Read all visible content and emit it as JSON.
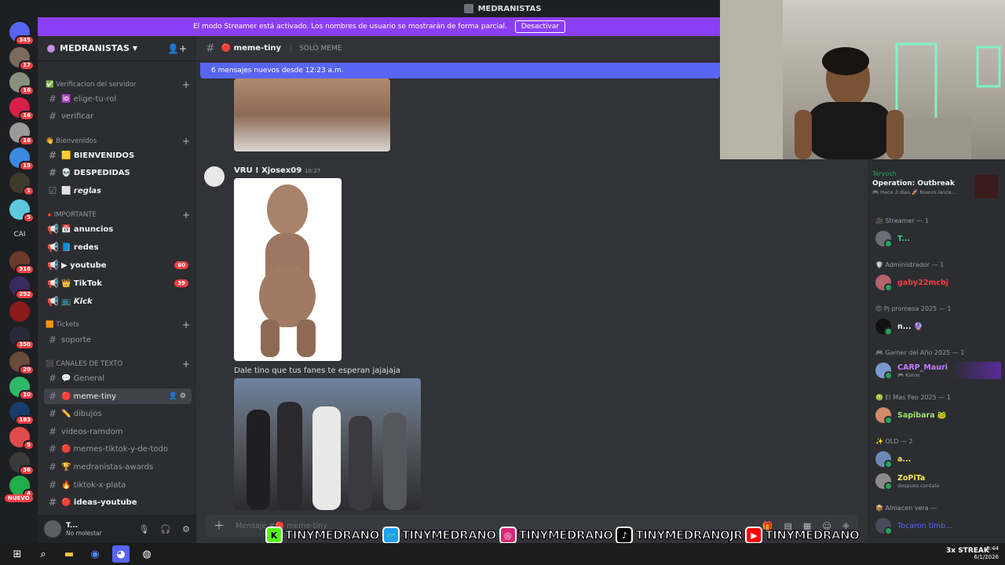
{
  "window": {
    "title": "MEDRANISTAS"
  },
  "banner": {
    "text": "El modo Streamer está activado. Los nombres de usuario se mostrarán de forma parcial.",
    "button": "Desactivar"
  },
  "rail": {
    "badges": [
      "345",
      "17",
      "16",
      "16",
      "16",
      "15",
      "16",
      "1",
      "5",
      "316",
      "292",
      "350",
      "20",
      "10",
      "183",
      "5",
      "36",
      "4"
    ],
    "new_label": "NUEVO",
    "cai_label": "CAI"
  },
  "server": {
    "name": "MEDRANISTAS"
  },
  "categories": {
    "verificacion": "✅ Verificacion del servidor",
    "bienvenidos": "👋 Bienvenidos",
    "importante": "🔺IMPORTANTE",
    "tickets": "🟧 Tickets",
    "canales": "⬛ CANALES DE TEXTO"
  },
  "channels": {
    "elige": "🆔 elige-tu-rol",
    "verificar": "verificar",
    "bienvenidos": "🟨 BIENVENIDOS",
    "despedidas": "💀 DESPEDIDAS",
    "reglas": "⬜ 𝙧𝙚𝙜𝙡𝙖𝙨",
    "anuncios": "📅 anuncios",
    "redes": "📘 redes",
    "youtube": "▶ youtube",
    "youtube_count": "60",
    "tiktok": "👑 TikTok",
    "tiktok_count": "39",
    "kick": "📺 𝙆𝙞𝙘𝙠",
    "soporte": "soporte",
    "general": "💬 General",
    "meme_tiny": "🔴 meme-tiny",
    "dibujos": "✏️ dibujos",
    "videos": "videos-ramdom",
    "memes_tiktok": "🔴 memes-tiktok-y-de-todo",
    "awards": "🏆 medranistas-awards",
    "tiktok_plata": "🔥 tiktok-x-plata",
    "ideas": "🔴 ideas-youtube"
  },
  "user": {
    "name": "T...",
    "status": "No molestar"
  },
  "chat": {
    "channel_name": "🔴 meme-tiny",
    "topic": "SOLO MEME",
    "new_messages": "6 mensajes nuevos desde 12:23 a.m.",
    "author": "VRU ! Xjosex09",
    "time": "18:27",
    "message": "Dale tino que tus fanes te esperan jajajaja",
    "composer_placeholder": "Mensaje #🔴 meme-tiny"
  },
  "members": {
    "activity": {
      "user": "Tervosh",
      "game": "Operation: Outbreak",
      "meta": "🎮 Hace 3 días  🚀 Nuevo lanza..."
    },
    "roles": [
      {
        "label": "🎥 Streamer — 1",
        "members": [
          {
            "name": "T...",
            "sub": "",
            "color": "#3ecf8e"
          }
        ]
      },
      {
        "label": "🛡️ Administrador — 1",
        "members": [
          {
            "name": "gaby22mcbj",
            "sub": "",
            "color": "#f23f43"
          }
        ]
      },
      {
        "label": "😊 Pj promesa 2025 — 1",
        "members": [
          {
            "name": "n... 🔮",
            "sub": "",
            "color": "#f2f3f5"
          }
        ]
      },
      {
        "label": "🎮 Gamer del Año 2025 — 1",
        "members": [
          {
            "name": "CARP_Mauri",
            "sub": "🎮 Karos",
            "color": "#c67bff"
          }
        ]
      },
      {
        "label": "🤢 El Mas Feo 2025 — 1",
        "members": [
          {
            "name": "Sapibara 🐸",
            "sub": "",
            "color": "#9be36b"
          }
        ]
      },
      {
        "label": "✨ OLD — 2",
        "members": [
          {
            "name": "a...",
            "sub": "",
            "color": "#f5e663"
          },
          {
            "name": "ZoPiTa",
            "sub": "despues contala",
            "color": "#f5e663"
          }
        ]
      },
      {
        "label": "📦 Almacen vera —",
        "members": [
          {
            "name": "Tocaron timb...",
            "sub": "",
            "color": "#5865f2"
          }
        ]
      }
    ]
  },
  "social": {
    "kick": "TINYMEDRANO",
    "twitter": "TINYMEDRANO",
    "instagram": "TINYMEDRANO",
    "tiktok": "TINYMEDRANOJR",
    "youtube": "TINYMEDRANO"
  },
  "overlay": {
    "streak": "3x STREAK"
  },
  "taskbar": {
    "time": "0:44",
    "date": "6/1/2026"
  },
  "colors": {
    "accent": "#5865f2",
    "banner": "#8b3ff5",
    "danger": "#f23f43",
    "online": "#23a559"
  }
}
